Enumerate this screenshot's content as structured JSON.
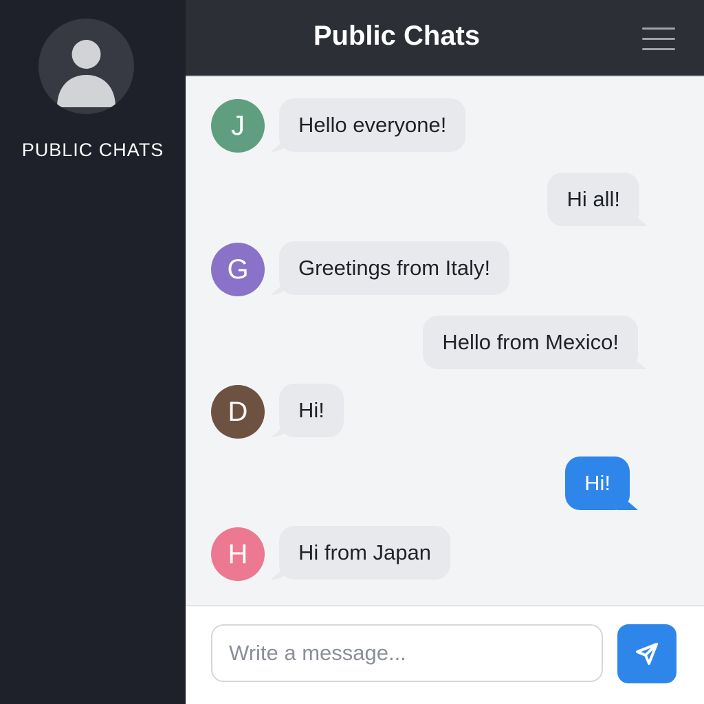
{
  "sidebar": {
    "title": "PUBLIC CHATS",
    "avatar_icon": "user-icon"
  },
  "header": {
    "title": "Public Chats",
    "menu_icon": "hamburger-menu-icon"
  },
  "messages": [
    {
      "side": "left",
      "initial": "J",
      "avatar_color": "#5f9e7f",
      "text": "Hello everyone!"
    },
    {
      "side": "right",
      "text": "Hi all!"
    },
    {
      "side": "left",
      "initial": "G",
      "avatar_color": "#8a72c8",
      "text": "Greetings from Italy!"
    },
    {
      "side": "right",
      "text": "Hello from Mexico!"
    },
    {
      "side": "left",
      "initial": "D",
      "avatar_color": "#6e5241",
      "text": "Hi!"
    },
    {
      "side": "right",
      "own": true,
      "text": "Hi!"
    },
    {
      "side": "left",
      "initial": "H",
      "avatar_color": "#ed7892",
      "text": "Hi from Japan"
    }
  ],
  "composer": {
    "placeholder": "Write a message...",
    "value": "",
    "send_icon": "send-icon"
  },
  "colors": {
    "sidebar_bg": "#1e2129",
    "header_bg": "#2c2f36",
    "accent": "#2f86ea",
    "bubble_bg": "#e8e9ec"
  }
}
